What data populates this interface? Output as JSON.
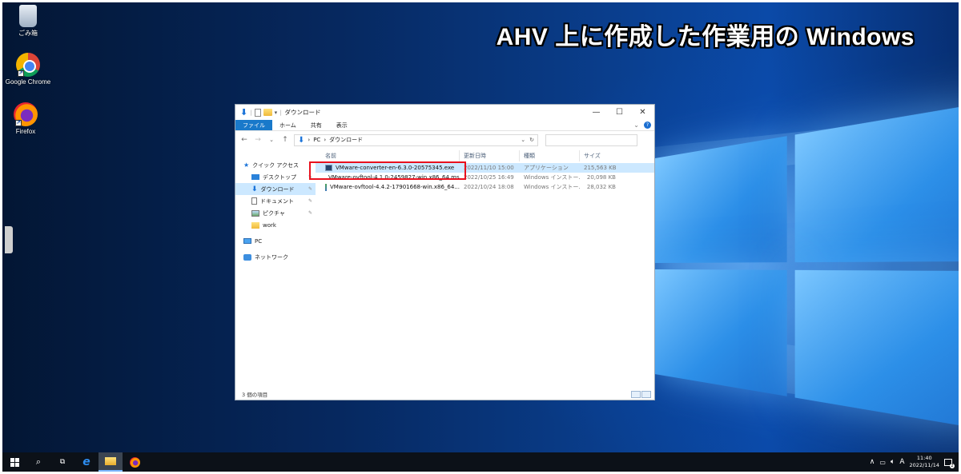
{
  "banner": "AHV 上に作成した作業用の Windows",
  "desktop_icons": [
    {
      "label": "ごみ箱"
    },
    {
      "label": "Google Chrome"
    },
    {
      "label": "Firefox"
    }
  ],
  "explorer": {
    "title": "ダウンロード",
    "controls": {
      "minimize": "—",
      "maximize": "☐",
      "close": "✕"
    },
    "ribbon_tabs": [
      "ファイル",
      "ホーム",
      "共有",
      "表示"
    ],
    "address": {
      "parts": [
        "PC",
        "ダウンロード"
      ]
    },
    "nav": [
      {
        "label": "クイック アクセス"
      },
      {
        "label": "デスクトップ"
      },
      {
        "label": "ダウンロード"
      },
      {
        "label": "ドキュメント"
      },
      {
        "label": "ピクチャ"
      },
      {
        "label": "work"
      },
      {
        "label": "PC"
      },
      {
        "label": "ネットワーク"
      }
    ],
    "columns": {
      "name": "名前",
      "date": "更新日時",
      "type": "種類",
      "size": "サイズ"
    },
    "files": [
      {
        "name": "VMware-converter-en-6.3.0-20575345.exe",
        "date": "2022/11/10 15:00",
        "type": "アプリケーション",
        "size": "215,563 KB"
      },
      {
        "name": "VMware-ovftool-4.1.0-2459827-win.x86_64.msi",
        "date": "2022/10/25 16:49",
        "type": "Windows インストー...",
        "size": "20,098 KB"
      },
      {
        "name": "VMware-ovftool-4.4.2-17901668-win.x86_64...",
        "date": "2022/10/24 18:08",
        "type": "Windows インストー...",
        "size": "28,032 KB"
      }
    ],
    "status": "3 個の項目"
  },
  "taskbar": {
    "tray": {
      "ime": "A",
      "time": "11:40",
      "date": "2022/11/14"
    }
  },
  "colors": {
    "accent": "#1979ca",
    "highlight": "#e8111e",
    "selection": "#cce8ff"
  }
}
